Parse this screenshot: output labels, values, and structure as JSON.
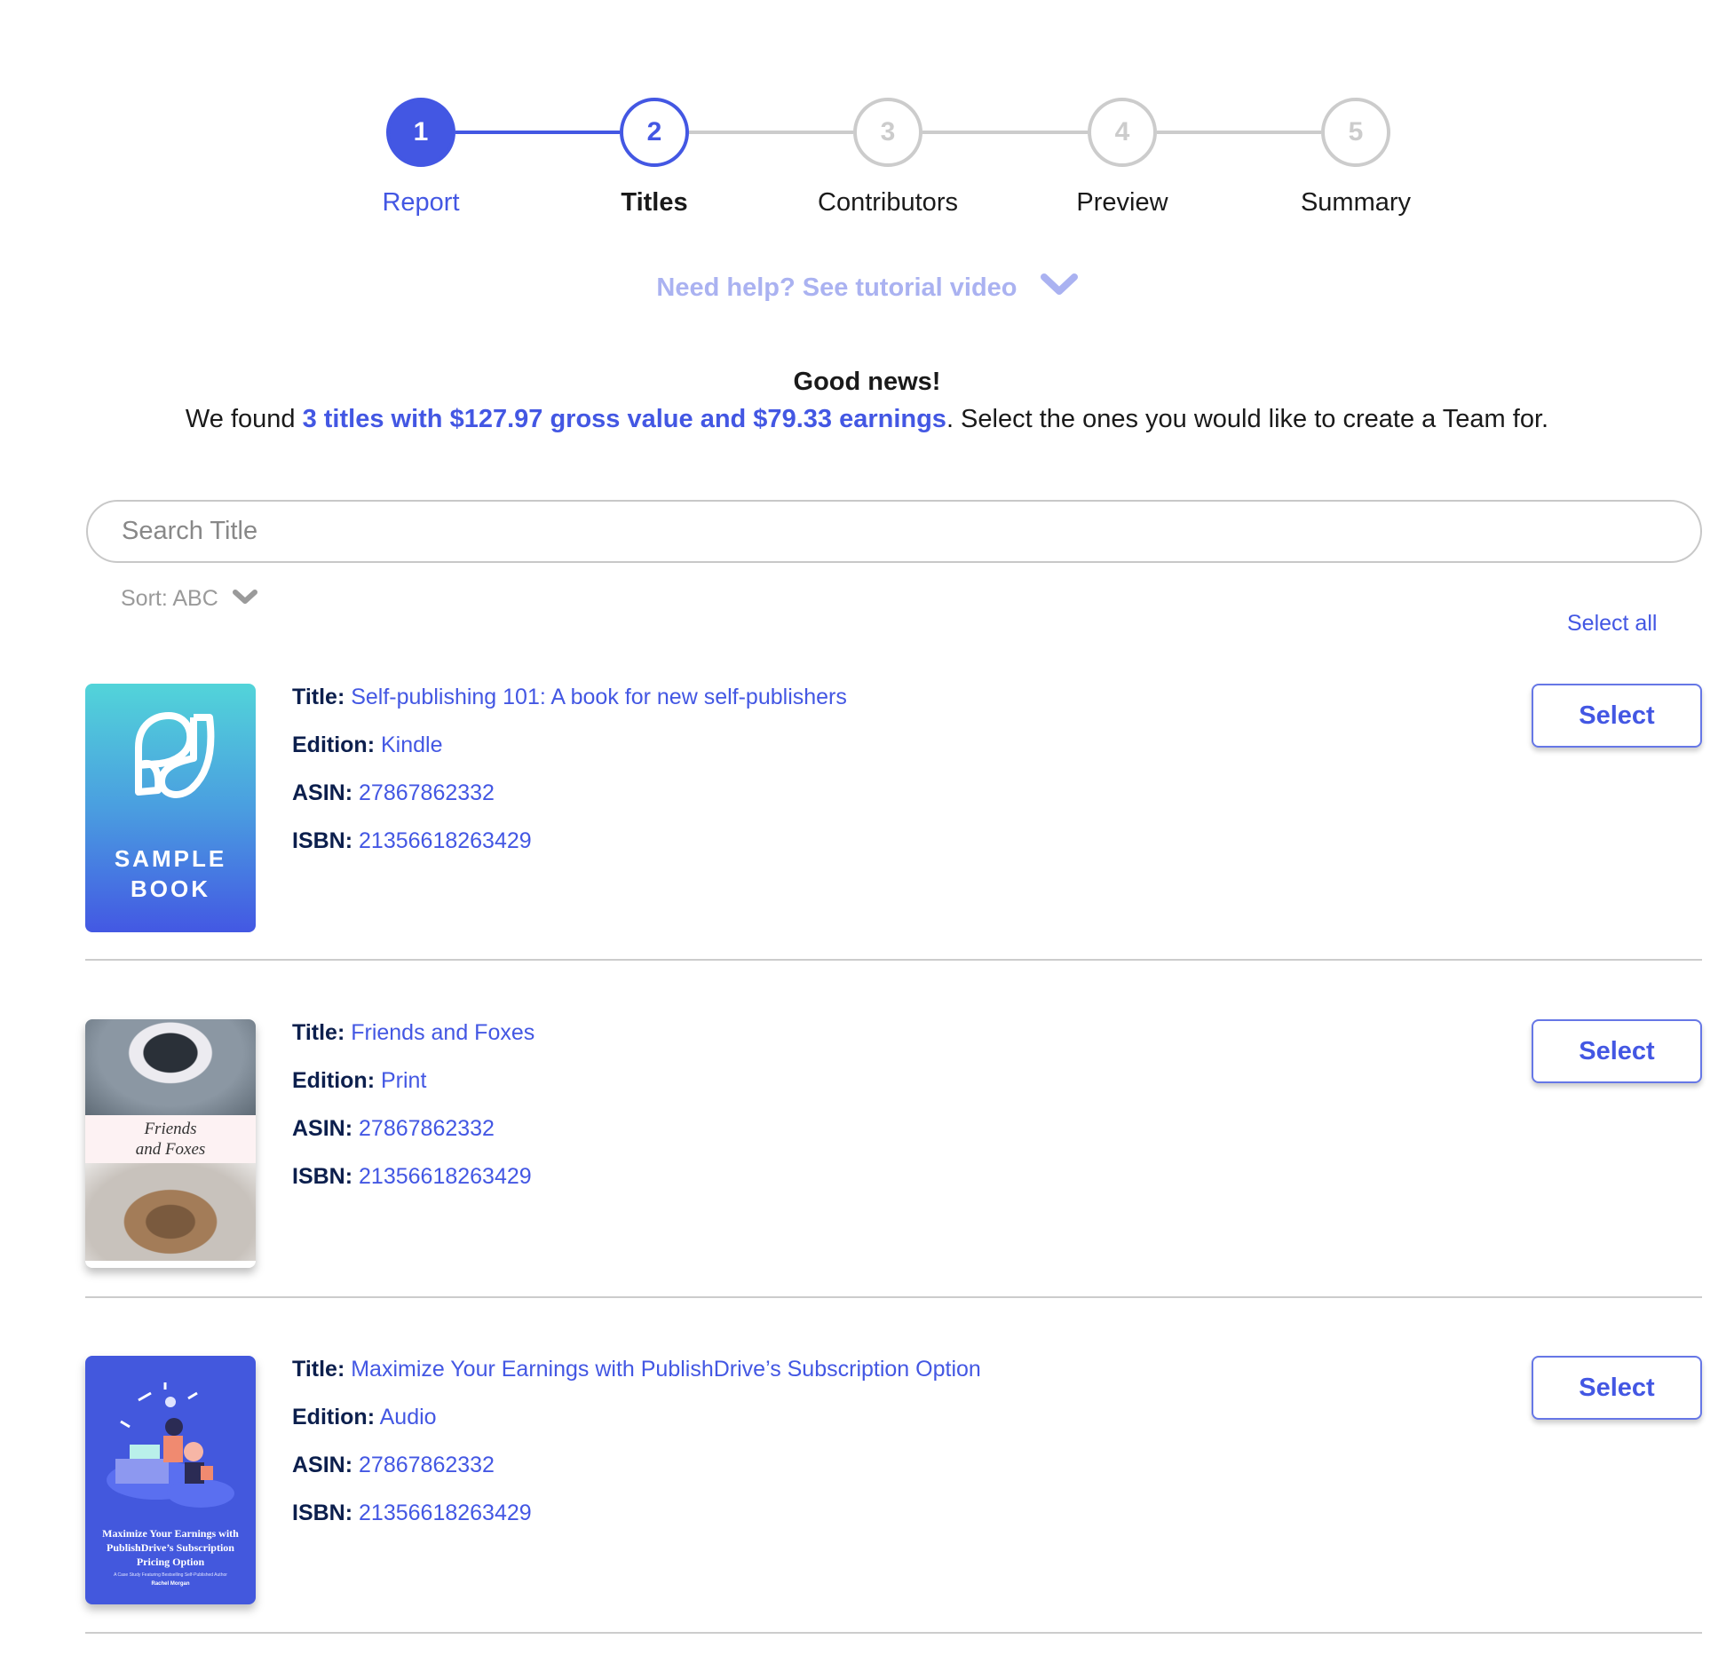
{
  "stepper": {
    "steps": [
      {
        "number": "1",
        "label": "Report",
        "state": "done"
      },
      {
        "number": "2",
        "label": "Titles",
        "state": "active"
      },
      {
        "number": "3",
        "label": "Contributors",
        "state": "pending"
      },
      {
        "number": "4",
        "label": "Preview",
        "state": "pending"
      },
      {
        "number": "5",
        "label": "Summary",
        "state": "pending"
      }
    ]
  },
  "help": {
    "label": "Need help? See tutorial video",
    "icon": "chevron-down-icon"
  },
  "intro": {
    "heading": "Good news!",
    "prefix": "We found ",
    "highlight": "3 titles with $127.97 gross value and $79.33 earnings",
    "suffix": ". Select the ones you would like to create a Team for."
  },
  "search": {
    "placeholder": "Search Title",
    "value": ""
  },
  "sort": {
    "label": "Sort: ABC",
    "icon": "chevron-down-icon"
  },
  "select_all_label": "Select all",
  "labels": {
    "title": "Title:",
    "edition": "Edition:",
    "asin": "ASIN:",
    "isbn": "ISBN:"
  },
  "titles": [
    {
      "title": "Self-publishing 101: A book for new self-publishers",
      "edition": "Kindle",
      "asin": "27867862332",
      "isbn": "21356618263429",
      "cover": {
        "caption_line1": "SAMPLE",
        "caption_line2": "BOOK"
      },
      "button": "Select"
    },
    {
      "title": "Friends and Foxes",
      "edition": "Print",
      "asin": "27867862332",
      "isbn": "21356618263429",
      "cover": {
        "caption_line1": "Friends",
        "caption_line2": "and Foxes"
      },
      "button": "Select"
    },
    {
      "title": "Maximize Your Earnings with PublishDrive’s Subscription Option",
      "edition": "Audio",
      "asin": "27867862332",
      "isbn": "21356618263429",
      "cover": {
        "caption_line1": "Maximize Your Earnings with PublishDrive’s Subscription Pricing Option",
        "caption_line2": "A Case Study Featuring Bestselling Self-Published Author",
        "author": "Rachel Morgan"
      },
      "button": "Select"
    }
  ],
  "colors": {
    "accent": "#4357e3",
    "muted_accent": "#aab2f1",
    "inactive": "#cccccc",
    "label_dark": "#0c1f4d"
  }
}
